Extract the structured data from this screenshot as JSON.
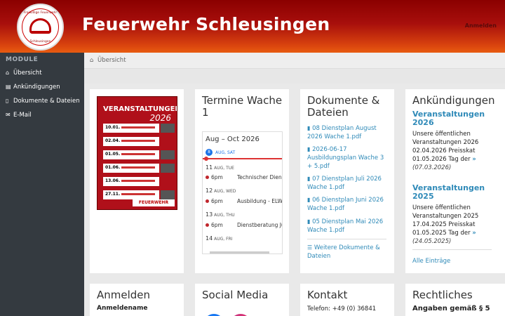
{
  "header": {
    "brand": "Feuerwehr Schleusingen",
    "login": "Anmelden",
    "logo_top": "Freiwillige Feuerwehr",
    "logo_bottom": "Schleusingen"
  },
  "sidebar": {
    "heading": "MODULE",
    "items": [
      {
        "label": "Übersicht",
        "icon": "home-icon"
      },
      {
        "label": "Ankündigungen",
        "icon": "newspaper-icon"
      },
      {
        "label": "Dokumente & Dateien",
        "icon": "file-icon"
      },
      {
        "label": "E-Mail",
        "icon": "envelope-icon"
      }
    ]
  },
  "breadcrumb": {
    "label": "Übersicht"
  },
  "poster": {
    "title": "VERANSTALTUNGEN",
    "year": "2026",
    "dates": [
      "10.01.",
      "02.04.",
      "01.05.",
      "01.06.",
      "13.06.",
      "27.11."
    ],
    "footer": "FEUERWEHR"
  },
  "termine": {
    "title": "Termine Wache 1",
    "range": "Aug – Oct 2026",
    "today_num": "8",
    "today_label": "AUG, SAT",
    "days": [
      {
        "num": "11",
        "label": "AUG, TUE",
        "time": "6pm",
        "event": "Technischer Dienst"
      },
      {
        "num": "12",
        "label": "AUG, WED",
        "time": "6pm",
        "event": "Ausbildung - ELW"
      },
      {
        "num": "13",
        "label": "AUG, THU",
        "time": "6pm",
        "event": "Dienstberatung Jugendfeuerwehr"
      },
      {
        "num": "14",
        "label": "AUG, FRI",
        "time": "",
        "event": ""
      }
    ]
  },
  "dokumente": {
    "title": "Dokumente & Dateien",
    "files": [
      "08 Dienstplan August 2026 Wache 1.pdf",
      "2026-06-17 Ausbildungsplan Wache 3 + 5.pdf",
      "07 Dienstplan Juli 2026 Wache 1.pdf",
      "06 Dienstplan Juni 2026 Wache 1.pdf",
      "05 Dienstplan Mai 2026 Wache 1.pdf"
    ],
    "more": "Weitere Dokumente & Dateien"
  },
  "ankuendigungen": {
    "title": "Ankündigungen",
    "items": [
      {
        "heading": "Veranstaltungen 2026",
        "text": "Unsere öffentlichen Veranstaltungen 2026 02.04.2026 Preisskat 01.05.2026 Tag der",
        "date": "(07.03.2026)"
      },
      {
        "heading": "Veranstaltungen 2025",
        "text": "Unsere öffentlichen Veranstaltungen 2025 17.04.2025 Preisskat 01.05.2025 Tag der",
        "date": "(24.05.2025)"
      }
    ],
    "more_glyph": "»",
    "all": "Alle Einträge"
  },
  "anmelden": {
    "title": "Anmelden",
    "field_label": "Anmeldename"
  },
  "social": {
    "title": "Social Media"
  },
  "kontakt": {
    "title": "Kontakt",
    "phone": "Telefon: +49 (0) 36841"
  },
  "rechtliches": {
    "title": "Rechtliches",
    "sub": "Angaben gemäß § 5"
  },
  "colors": {
    "header_top": "#8b0000",
    "header_bottom": "#e85c10",
    "sidebar": "#343a40",
    "link": "#2f8ab8"
  }
}
